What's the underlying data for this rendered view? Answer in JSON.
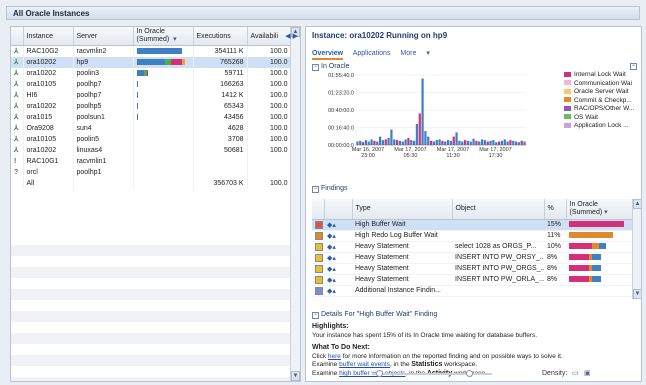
{
  "window": {
    "title": "All Oracle Instances"
  },
  "instances": {
    "columns": [
      "",
      "Instance",
      "Server",
      "In Oracle (Summed)",
      "Executions",
      "Availabili"
    ],
    "rows": [
      {
        "status": "run",
        "instance": "RAC10G2",
        "server": "racvmlin2",
        "in_oracle": [
          0.88,
          0,
          0,
          0
        ],
        "executions": "354111 K",
        "avail": "100.0"
      },
      {
        "status": "run",
        "instance": "ora10202",
        "server": "hp9",
        "in_oracle": [
          0.55,
          0.12,
          0.2,
          0.06
        ],
        "executions": "765268",
        "avail": "100.0",
        "selected": true
      },
      {
        "status": "run",
        "instance": "ora10202",
        "server": "poolin3",
        "in_oracle": [
          0.15,
          0.05,
          0.03,
          0
        ],
        "executions": "59711",
        "avail": "100.0"
      },
      {
        "status": "run",
        "instance": "ora10105",
        "server": "poolhp7",
        "in_oracle": [
          0.03,
          0,
          0,
          0
        ],
        "executions": "166263",
        "avail": "100.0"
      },
      {
        "status": "run",
        "instance": "HI6",
        "server": "poolhp7",
        "in_oracle": [
          0.02,
          0,
          0,
          0
        ],
        "executions": "1412 K",
        "avail": "100.0"
      },
      {
        "status": "run",
        "instance": "ora10202",
        "server": "poolhp5",
        "in_oracle": [
          0.015,
          0,
          0,
          0
        ],
        "executions": "65343",
        "avail": "100.0"
      },
      {
        "status": "run",
        "instance": "ora1015",
        "server": "poolsun1",
        "in_oracle": [
          0.015,
          0,
          0,
          0
        ],
        "executions": "43456",
        "avail": "100.0"
      },
      {
        "status": "run",
        "instance": "Ora9208",
        "server": "sun4",
        "in_oracle": [
          0,
          0,
          0,
          0
        ],
        "executions": "4628",
        "avail": "100.0"
      },
      {
        "status": "run",
        "instance": "ora10105",
        "server": "poolin5",
        "in_oracle": [
          0,
          0,
          0,
          0
        ],
        "executions": "3708",
        "avail": "100.0"
      },
      {
        "status": "run",
        "instance": "ora10202",
        "server": "linuxas4",
        "in_oracle": [
          0,
          0,
          0,
          0
        ],
        "executions": "50681",
        "avail": "100.0"
      },
      {
        "status": "down",
        "instance": "RAC10G1",
        "server": "racvmlin1",
        "in_oracle": [
          0,
          0,
          0,
          0
        ],
        "executions": "",
        "avail": ""
      },
      {
        "status": "unknown",
        "instance": "orcl",
        "server": "poolhp1",
        "in_oracle": [
          0,
          0,
          0,
          0
        ],
        "executions": "",
        "avail": ""
      },
      {
        "status": "",
        "instance": "All",
        "server": "",
        "in_oracle": [
          0,
          0,
          0,
          0
        ],
        "executions": "356703 K",
        "avail": "100.0"
      }
    ],
    "bar_colors": [
      "#3f7fc3",
      "#4caf50",
      "#d4307a",
      "#e8a33b"
    ]
  },
  "detail": {
    "title": "Instance: ora10202 Running on hp9",
    "tabs": {
      "overview": "Overview",
      "applications": "Applications",
      "more": "More"
    },
    "in_oracle": {
      "header": "In Oracle",
      "legend": [
        {
          "label": "Internal Lock Wait",
          "color": "#d4307a"
        },
        {
          "label": "Communication Wai",
          "color": "#f2b6d3"
        },
        {
          "label": "Oracle Server Wait",
          "color": "#ffc66e"
        },
        {
          "label": "Commit & Checkp...",
          "color": "#e08b2b"
        },
        {
          "label": "RAC/OPS/Other W...",
          "color": "#8e5ab5"
        },
        {
          "label": "OS Wait",
          "color": "#6bbf5b"
        },
        {
          "label": "Application Lock ...",
          "color": "#c9a0dc"
        }
      ]
    },
    "chart_data": {
      "type": "bar",
      "y_ticks": [
        "01:55:40.0",
        "01:23:20.0",
        "00:40:00.0",
        "00:16:40.0",
        "00:00:00.0"
      ],
      "x_ticks": [
        "Mar 16, 2007\n23:00",
        "Mar 17, 2007\n05:30",
        "Mar 17, 2007\n11:30",
        "Mar 17, 2007\n17:30"
      ],
      "values": [
        0.05,
        0.06,
        0.04,
        0.07,
        0.05,
        0.08,
        0.06,
        0.05,
        0.12,
        0.07,
        0.08,
        0.1,
        0.22,
        0.08,
        0.07,
        0.06,
        0.05,
        0.08,
        0.1,
        0.07,
        0.06,
        0.3,
        0.45,
        0.95,
        0.2,
        0.12,
        0.06,
        0.05,
        0.07,
        0.08,
        0.06,
        0.05,
        0.07,
        0.06,
        0.12,
        0.18,
        0.06,
        0.05,
        0.07,
        0.06,
        0.05,
        0.09,
        0.06,
        0.05,
        0.08,
        0.07,
        0.05,
        0.06,
        0.07,
        0.04,
        0.05,
        0.06,
        0.08,
        0.05,
        0.07,
        0.06,
        0.05,
        0.04,
        0.06,
        0.05
      ],
      "colors": [
        "#3f7fc3",
        "#3f7fc3",
        "#d4307a",
        "#3f7fc3"
      ]
    },
    "findings": {
      "header": "Findings",
      "columns": [
        "",
        "",
        "Type",
        "Object",
        "%",
        "In Oracle (Summed)"
      ],
      "rows": [
        {
          "sev": "#d9534f",
          "type": "High Buffer Wait",
          "object": "",
          "pct": "15%",
          "bar": [
            0.95,
            0,
            0
          ],
          "selected": true
        },
        {
          "sev": "#e08b2b",
          "type": "High Redo Log Buffer Wait",
          "object": "",
          "pct": "11%",
          "bar": [
            0,
            0.75,
            0
          ]
        },
        {
          "sev": "#e6c22e",
          "type": "Heavy Statement",
          "object": "select 1028 as ORGS_P...",
          "pct": "10%",
          "bar": [
            0.4,
            0.12,
            0.12
          ]
        },
        {
          "sev": "#e6c22e",
          "type": "Heavy Statement",
          "object": "INSERT INTO PW_ORSY_...",
          "pct": "8%",
          "bar": [
            0.35,
            0.05,
            0.15
          ]
        },
        {
          "sev": "#e6c22e",
          "type": "Heavy Statement",
          "object": "INSERT INTO PW_ORGS_...",
          "pct": "8%",
          "bar": [
            0.35,
            0.05,
            0.15
          ]
        },
        {
          "sev": "#e6c22e",
          "type": "Heavy Statement",
          "object": "INSERT INTO PW_ORLA_...",
          "pct": "8%",
          "bar": [
            0.35,
            0.05,
            0.15
          ]
        },
        {
          "sev": "#7b8fd0",
          "type": "Additional Instance Findin...",
          "object": "",
          "pct": "",
          "bar": [
            0,
            0,
            0
          ]
        }
      ],
      "bar_colors": [
        "#d4307a",
        "#e08b2b",
        "#3f7fc3"
      ]
    },
    "details": {
      "header": "Details For \"High Buffer Wait\" Finding",
      "highlights_label": "Highlights:",
      "highlights_text": "Your instance has spent 15% of its In Oracle time waiting for database buffers.",
      "todo_label": "What To Do Next:",
      "line1_pre": "Click ",
      "line1_link": "here",
      "line1_post": " for more information on the reported finding and on possible ways to solve it.",
      "line2_pre": "Examine ",
      "line2_link": "buffer wait events",
      "line2_mid": ", in the ",
      "line2_ws": "Statistics",
      "line2_post": " workspace.",
      "line3_pre": "Examine ",
      "line3_link": "high buffer wait objects",
      "line3_mid": ", in the ",
      "line3_ws": "Activity",
      "line3_post": " workspace."
    },
    "density_label": "Density:"
  }
}
